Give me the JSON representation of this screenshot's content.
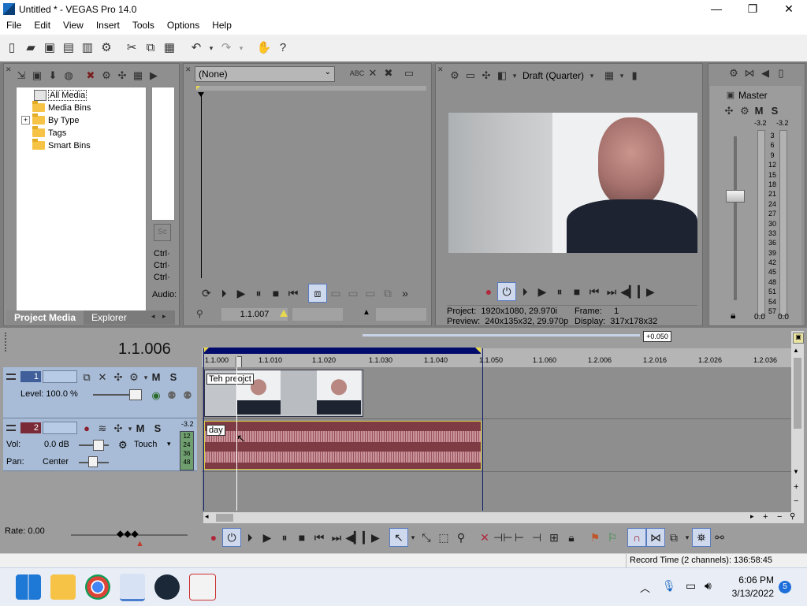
{
  "window": {
    "title": "Untitled * - VEGAS Pro 14.0",
    "min": "—",
    "max": "❐",
    "close": "✕"
  },
  "menu": [
    "File",
    "Edit",
    "View",
    "Insert",
    "Tools",
    "Options",
    "Help"
  ],
  "toolbar_icons": [
    "new-icon",
    "open-icon",
    "save-icon",
    "save-as-icon",
    "render-icon",
    "settings-icon",
    "cut-icon",
    "copy-icon",
    "paste-icon",
    "undo-icon",
    "redo-icon",
    "plugin-icon",
    "help-icon"
  ],
  "project_media": {
    "tree": [
      {
        "label": "All Media",
        "selected": true,
        "expand": ""
      },
      {
        "label": "Media Bins",
        "selected": false,
        "expand": ""
      },
      {
        "label": "By Type",
        "selected": false,
        "expand": "+"
      },
      {
        "label": "Tags",
        "selected": false,
        "expand": ""
      },
      {
        "label": "Smart Bins",
        "selected": false,
        "expand": ""
      }
    ],
    "side_labels": [
      "Ctrl·",
      "Ctrl·",
      "Ctrl·",
      "Audio:"
    ],
    "tabs": [
      "Project Media",
      "Explorer"
    ]
  },
  "trimmer": {
    "dropdown": "(None)",
    "timecode": "1.1.007"
  },
  "preview": {
    "quality": "Draft (Quarter)",
    "project_label": "Project:",
    "project_value": "1920x1080, 29.970i",
    "frame_label": "Frame:",
    "frame_value": "1",
    "preview_label": "Preview:",
    "preview_value": "240x135x32, 29.970p",
    "display_label": "Display:",
    "display_value": "317x178x32"
  },
  "master": {
    "title": "Master",
    "m": "M",
    "s": "S",
    "peak_left": "-3.2",
    "peak_right": "-3.2",
    "scale": [
      "3",
      "6",
      "9",
      "12",
      "15",
      "18",
      "21",
      "24",
      "27",
      "30",
      "33",
      "36",
      "39",
      "42",
      "45",
      "48",
      "51",
      "54",
      "57"
    ],
    "bottom_left": "0.0",
    "bottom_right": "0.0"
  },
  "timeline": {
    "timecode": "1.1.006",
    "offset": "+0.050",
    "ruler": [
      "1.1.000",
      "1.1.010",
      "1.1.020",
      "1.1.030",
      "1.1.040",
      "1.1.050",
      "1.1.060",
      "1.2.006",
      "1.2.016",
      "1.2.026",
      "1.2.036"
    ],
    "video_track": {
      "num": "1",
      "level_label": "Level: 100.0 %",
      "m": "M",
      "s": "S",
      "clip_label": "Teh preojct"
    },
    "audio_track": {
      "num": "2",
      "vol_label": "Vol:",
      "vol_value": "0.0 dB",
      "pan_label": "Pan:",
      "pan_value": "Center",
      "touch": "Touch",
      "m": "M",
      "s": "S",
      "meter_peak": "-3.2",
      "meter_scale": [
        "12",
        "24",
        "36",
        "48"
      ],
      "clip_label": "day"
    },
    "rate": "Rate: 0.00"
  },
  "status": {
    "record_time": "Record Time (2 channels): 136:58:45"
  },
  "taskbar": {
    "time": "6:06 PM",
    "date": "3/13/2022",
    "badge": "5",
    "apps": [
      "windows-start-icon",
      "file-explorer-icon",
      "chrome-icon",
      "vegas-icon",
      "steam-icon",
      "document-app-icon"
    ]
  }
}
